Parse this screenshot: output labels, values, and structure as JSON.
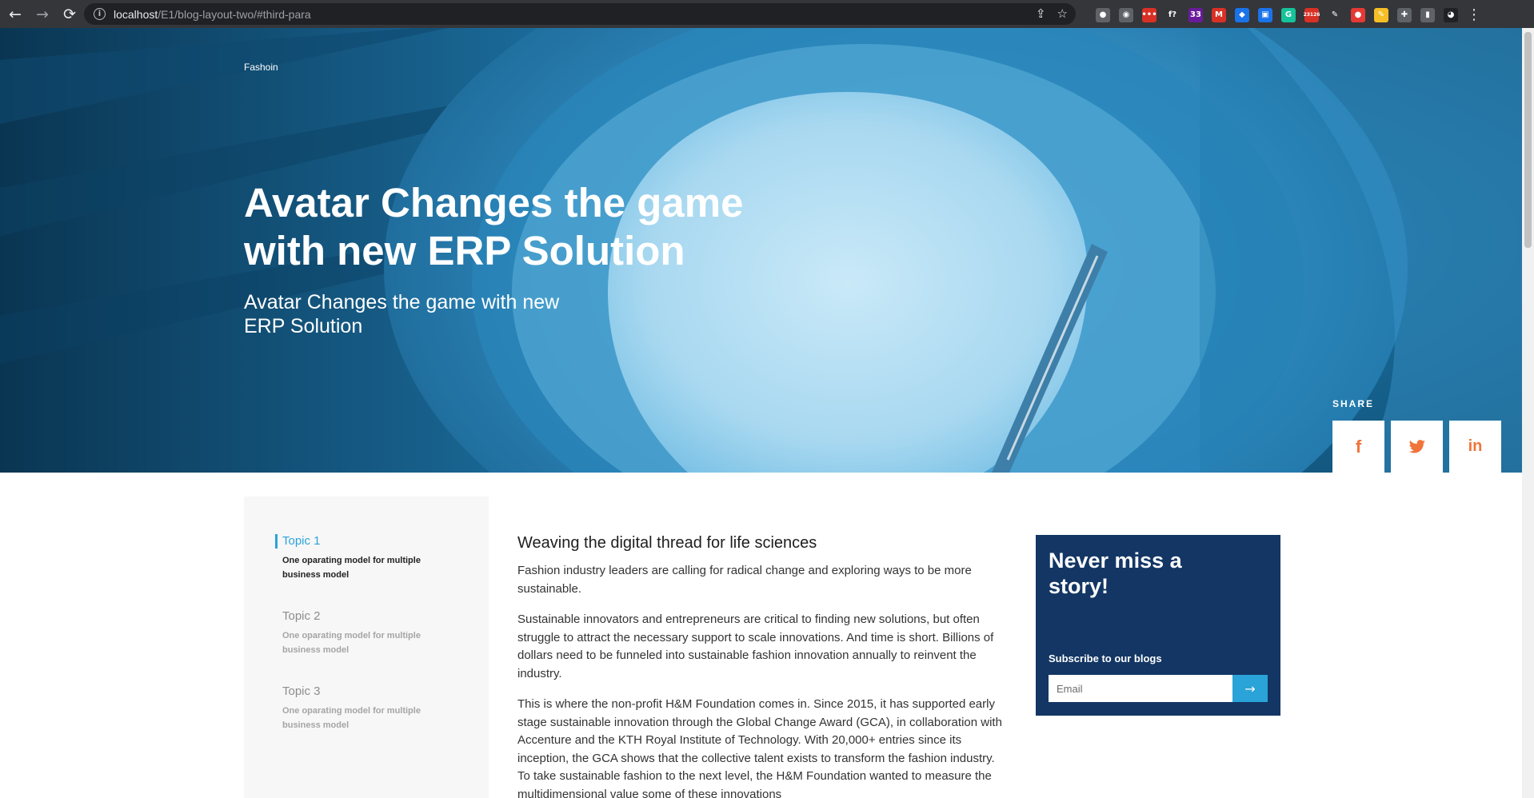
{
  "browser": {
    "url_host": "localhost",
    "url_path": "/E1/blog-layout-two/#third-para",
    "nav": {
      "back": "←",
      "forward": "→",
      "reload": "⟳"
    },
    "omni_icons": [
      "⇪",
      "☆"
    ],
    "extensions": [
      {
        "label": "●",
        "color": "#5f6368"
      },
      {
        "label": "◉",
        "color": "#5f6368"
      },
      {
        "label": "•••",
        "color": "#d93025"
      },
      {
        "label": "f?",
        "color": "#35363a"
      },
      {
        "label": "33",
        "color": "#6a1b9a"
      },
      {
        "label": "M",
        "color": "#d93025"
      },
      {
        "label": "◆",
        "color": "#1a73e8"
      },
      {
        "label": "▣",
        "color": "#1a73e8"
      },
      {
        "label": "G",
        "color": "#15c39a"
      },
      {
        "label": "23126",
        "color": "#d93025"
      },
      {
        "label": "✎",
        "color": "#35363a"
      },
      {
        "label": "●",
        "color": "#e53935"
      },
      {
        "label": "✎",
        "color": "#f6bf26"
      },
      {
        "label": "✚",
        "color": "#5f6368"
      },
      {
        "label": "▮",
        "color": "#5f6368"
      },
      {
        "label": "◕",
        "color": "#202124"
      }
    ],
    "menu": "⋮"
  },
  "hero": {
    "category": "Fashoin",
    "title": "Avatar Changes the game with new ERP Solution",
    "subtitle": "Avatar Changes the game with new ERP Solution",
    "share_label": "SHARE",
    "share_buttons": [
      {
        "name": "facebook",
        "glyph": "f"
      },
      {
        "name": "twitter",
        "glyph": "🐦"
      },
      {
        "name": "linkedin",
        "glyph": "in"
      }
    ]
  },
  "toc": {
    "items": [
      {
        "title": "Topic 1",
        "desc": "One oparating model for multiple business model",
        "active": true
      },
      {
        "title": "Topic 2",
        "desc": "One oparating model for multiple business model",
        "active": false
      },
      {
        "title": "Topic 3",
        "desc": "One oparating model for multiple business model",
        "active": false
      }
    ]
  },
  "article": {
    "heading": "Weaving the digital thread for life sciences",
    "paragraphs": [
      "Fashion industry leaders are calling for radical change and exploring ways to be more sustainable.",
      "Sustainable innovators and entrepreneurs are critical to finding new solutions, but often struggle to attract the necessary support to scale innovations. And time is short. Billions of dollars need to be funneled into sustainable fashion innovation annually to reinvent the industry.",
      "This is where the non-profit H&M Foundation comes in. Since 2015, it has supported early stage sustainable innovation through the Global Change Award (GCA), in collaboration with Accenture and the KTH Royal Institute of Technology. With 20,000+ entries since its inception, the GCA shows that the collective talent exists to transform the fashion industry. To take sustainable fashion to the next level, the H&M Foundation wanted to measure the multidimensional value some of these innovations"
    ]
  },
  "subscribe": {
    "title": "Never miss a story!",
    "label": "Subscribe to our blogs",
    "email_placeholder": "Email",
    "submit": "→"
  }
}
